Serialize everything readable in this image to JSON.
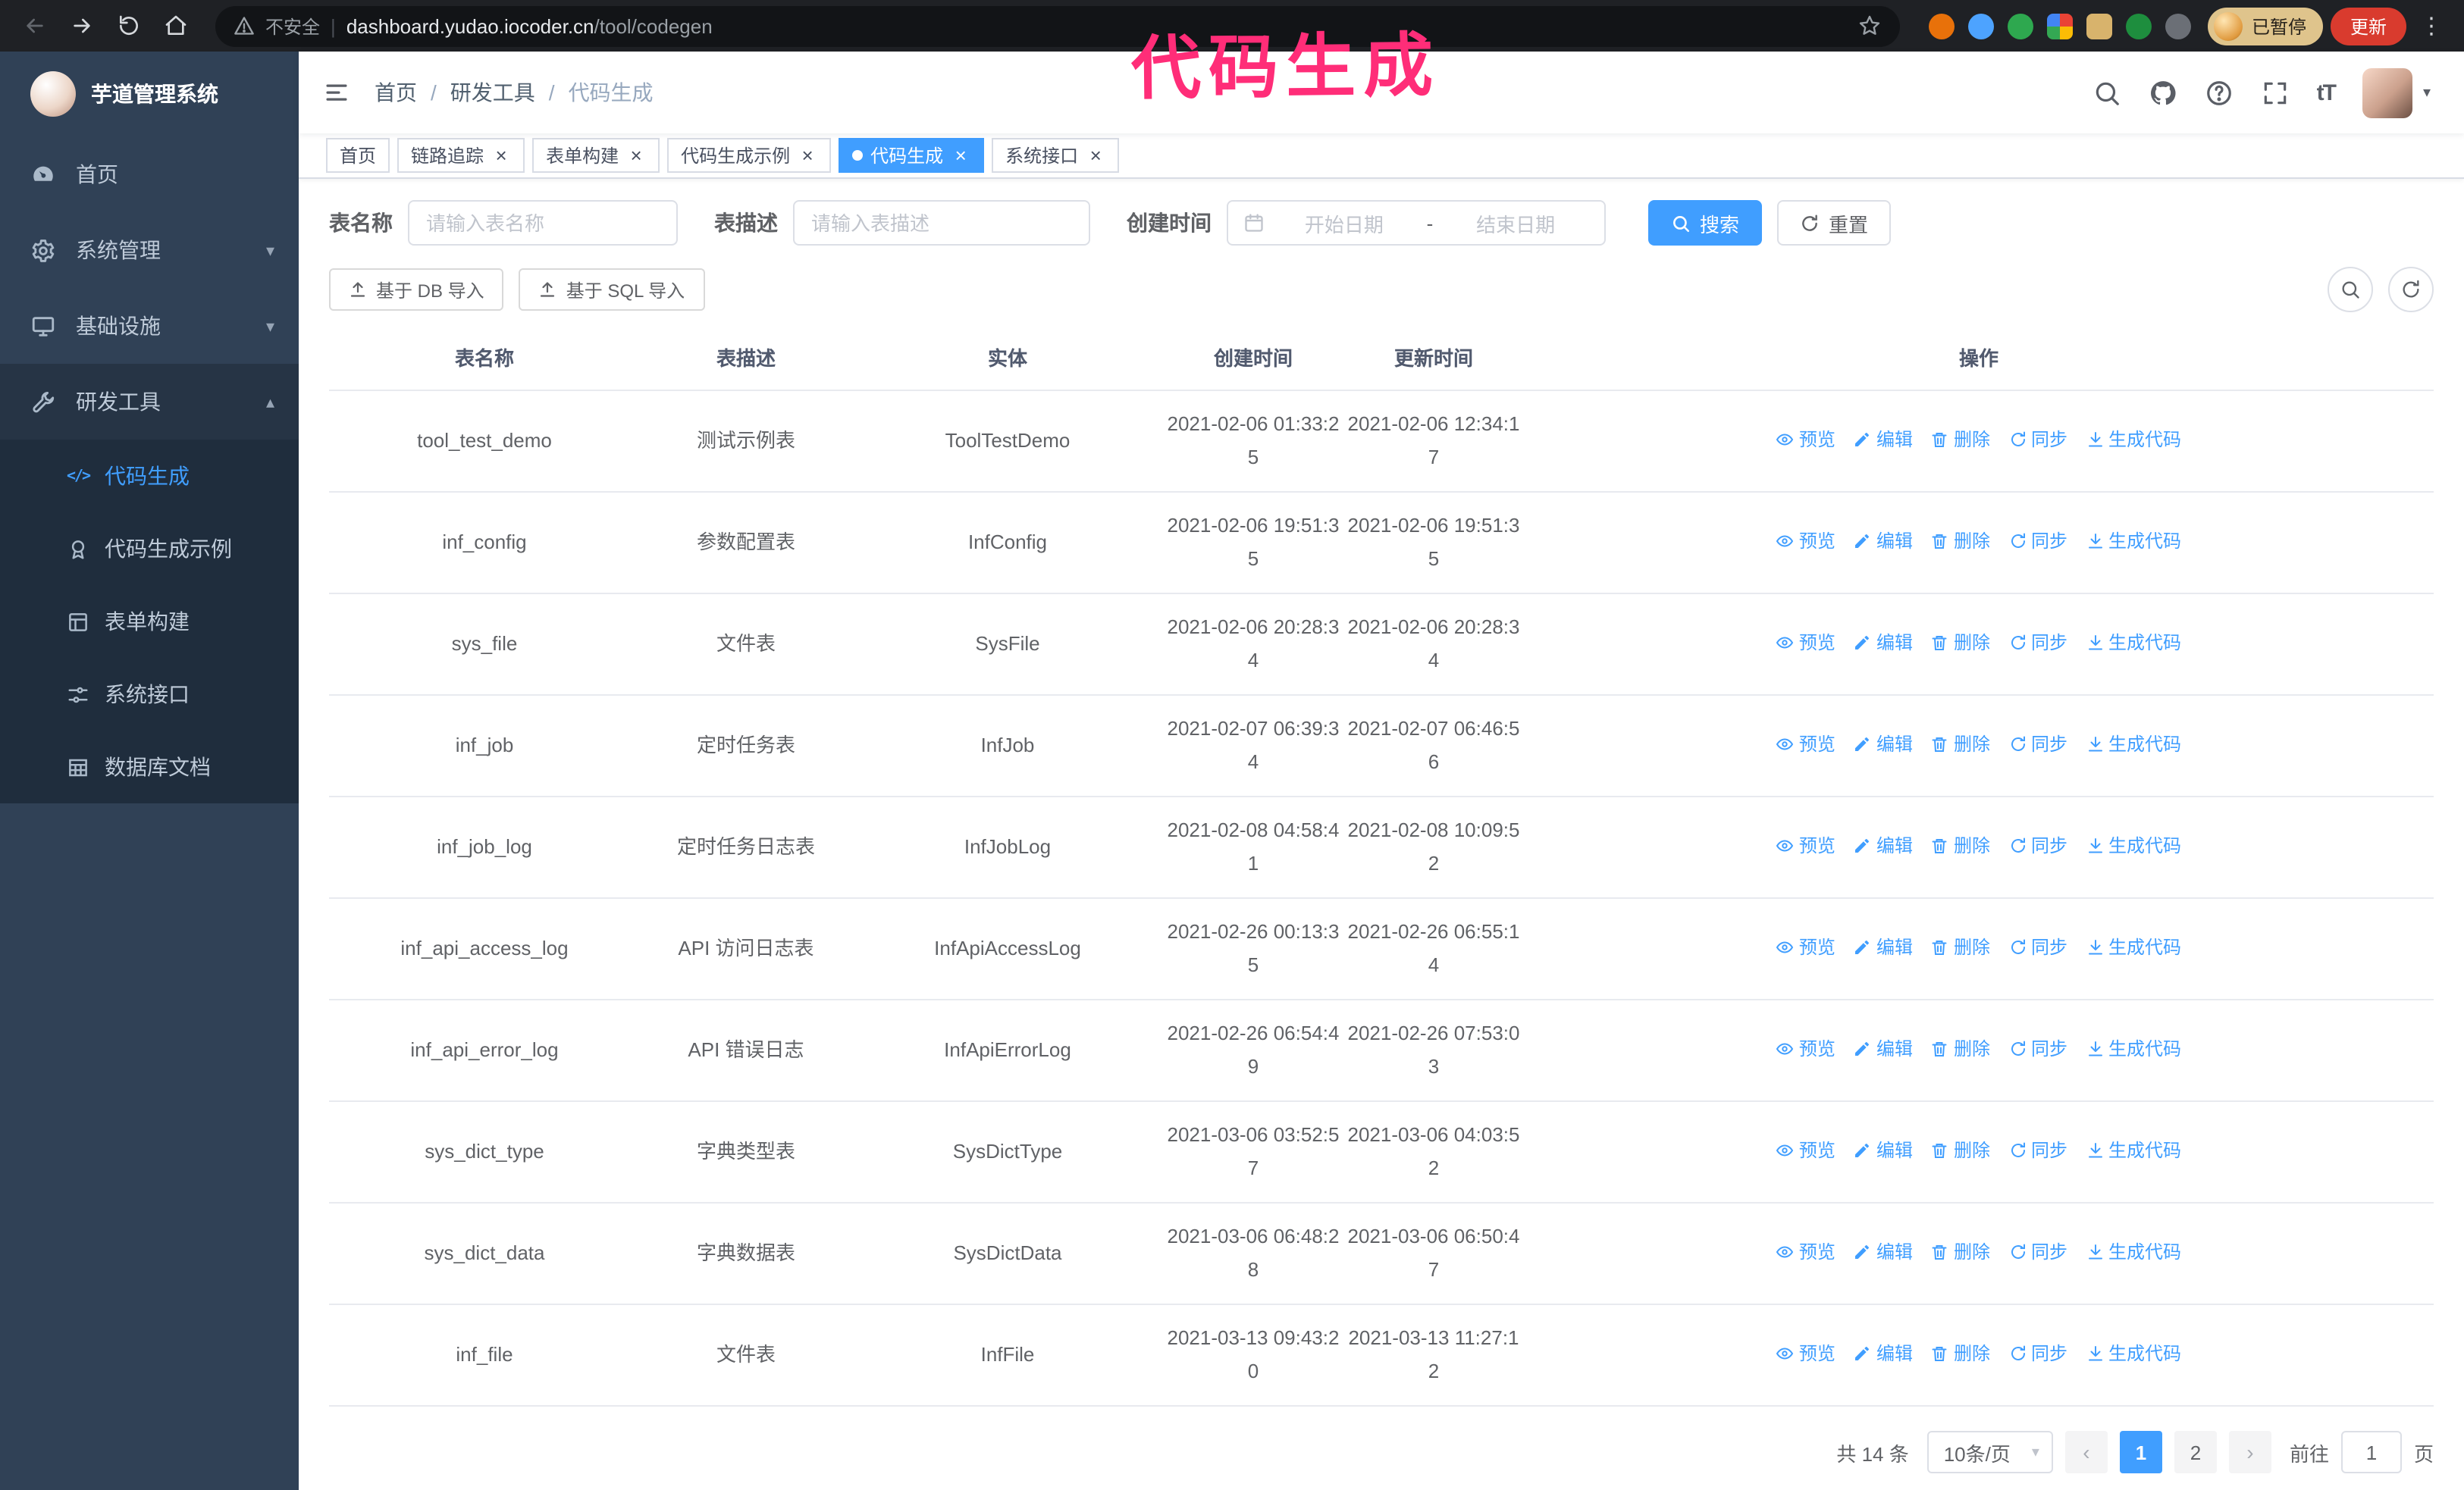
{
  "annotation": {
    "text": "代码生成",
    "color": "#ff2d78"
  },
  "browser": {
    "security_label": "不安全",
    "url_host": "dashboard.yudao.iocoder.cn",
    "url_path": "/tool/codegen",
    "profile_label": "已暂停",
    "update_label": "更新"
  },
  "app": {
    "logo_title": "芋道管理系统",
    "colors": {
      "accent": "#409eff",
      "sidebar_bg": "#304156",
      "submenu_bg": "#1f2d3d"
    }
  },
  "sidebar": {
    "items": [
      {
        "key": "home",
        "label": "首页",
        "icon": "dashboard"
      },
      {
        "key": "system-management",
        "label": "系统管理",
        "icon": "gear",
        "arrow": "down"
      },
      {
        "key": "infrastructure",
        "label": "基础设施",
        "icon": "monitor",
        "arrow": "down"
      },
      {
        "key": "dev-tools",
        "label": "研发工具",
        "icon": "tools",
        "arrow": "up",
        "open": true,
        "children": [
          {
            "key": "codegen",
            "label": "代码生成",
            "icon": "code",
            "active": true
          },
          {
            "key": "codegen-example",
            "label": "代码生成示例",
            "icon": "medal"
          },
          {
            "key": "form-builder",
            "label": "表单构建",
            "icon": "form"
          },
          {
            "key": "system-api",
            "label": "系统接口",
            "icon": "sliders"
          },
          {
            "key": "db-doc",
            "label": "数据库文档",
            "icon": "tabledoc"
          }
        ]
      }
    ]
  },
  "breadcrumb": [
    "首页",
    "研发工具",
    "代码生成"
  ],
  "tabs": [
    {
      "key": "home",
      "label": "首页",
      "closable": false
    },
    {
      "key": "tracing",
      "label": "链路追踪",
      "closable": true
    },
    {
      "key": "form-builder",
      "label": "表单构建",
      "closable": true
    },
    {
      "key": "codegen-example",
      "label": "代码生成示例",
      "closable": true
    },
    {
      "key": "codegen",
      "label": "代码生成",
      "closable": true,
      "active": true
    },
    {
      "key": "system-api",
      "label": "系统接口",
      "closable": true
    }
  ],
  "filters": {
    "name_label": "表名称",
    "name_placeholder": "请输入表名称",
    "desc_label": "表描述",
    "desc_placeholder": "请输入表描述",
    "time_label": "创建时间",
    "start_placeholder": "开始日期",
    "range_separator": "-",
    "end_placeholder": "结束日期",
    "search_label": "搜索",
    "reset_label": "重置"
  },
  "toolbar": {
    "import_db": "基于 DB 导入",
    "import_sql": "基于 SQL 导入"
  },
  "table": {
    "columns": [
      "表名称",
      "表描述",
      "实体",
      "创建时间",
      "更新时间",
      "操作"
    ],
    "actions": [
      {
        "key": "preview",
        "label": "预览",
        "icon": "eye"
      },
      {
        "key": "edit",
        "label": "编辑",
        "icon": "edit"
      },
      {
        "key": "delete",
        "label": "删除",
        "icon": "trash"
      },
      {
        "key": "sync",
        "label": "同步",
        "icon": "sync"
      },
      {
        "key": "generate",
        "label": "生成代码",
        "icon": "download"
      }
    ],
    "rows": [
      {
        "name": "tool_test_demo",
        "desc": "测试示例表",
        "entity": "ToolTestDemo",
        "created": "2021-02-06 01:33:25",
        "updated": "2021-02-06 12:34:17"
      },
      {
        "name": "inf_config",
        "desc": "参数配置表",
        "entity": "InfConfig",
        "created": "2021-02-06 19:51:35",
        "updated": "2021-02-06 19:51:35"
      },
      {
        "name": "sys_file",
        "desc": "文件表",
        "entity": "SysFile",
        "created": "2021-02-06 20:28:34",
        "updated": "2021-02-06 20:28:34"
      },
      {
        "name": "inf_job",
        "desc": "定时任务表",
        "entity": "InfJob",
        "created": "2021-02-07 06:39:34",
        "updated": "2021-02-07 06:46:56"
      },
      {
        "name": "inf_job_log",
        "desc": "定时任务日志表",
        "entity": "InfJobLog",
        "created": "2021-02-08 04:58:41",
        "updated": "2021-02-08 10:09:52"
      },
      {
        "name": "inf_api_access_log",
        "desc": "API 访问日志表",
        "entity": "InfApiAccessLog",
        "created": "2021-02-26 00:13:35",
        "updated": "2021-02-26 06:55:14"
      },
      {
        "name": "inf_api_error_log",
        "desc": "API 错误日志",
        "entity": "InfApiErrorLog",
        "created": "2021-02-26 06:54:49",
        "updated": "2021-02-26 07:53:03"
      },
      {
        "name": "sys_dict_type",
        "desc": "字典类型表",
        "entity": "SysDictType",
        "created": "2021-03-06 03:52:57",
        "updated": "2021-03-06 04:03:52"
      },
      {
        "name": "sys_dict_data",
        "desc": "字典数据表",
        "entity": "SysDictData",
        "created": "2021-03-06 06:48:28",
        "updated": "2021-03-06 06:50:47"
      },
      {
        "name": "inf_file",
        "desc": "文件表",
        "entity": "InfFile",
        "created": "2021-03-13 09:43:20",
        "updated": "2021-03-13 11:27:12"
      }
    ]
  },
  "pagination": {
    "total": "共 14 条",
    "page_size": "10条/页",
    "pages": [
      "1",
      "2"
    ],
    "active_page": "1",
    "goto_label": "前往",
    "goto_value": "1",
    "unit_label": "页"
  }
}
